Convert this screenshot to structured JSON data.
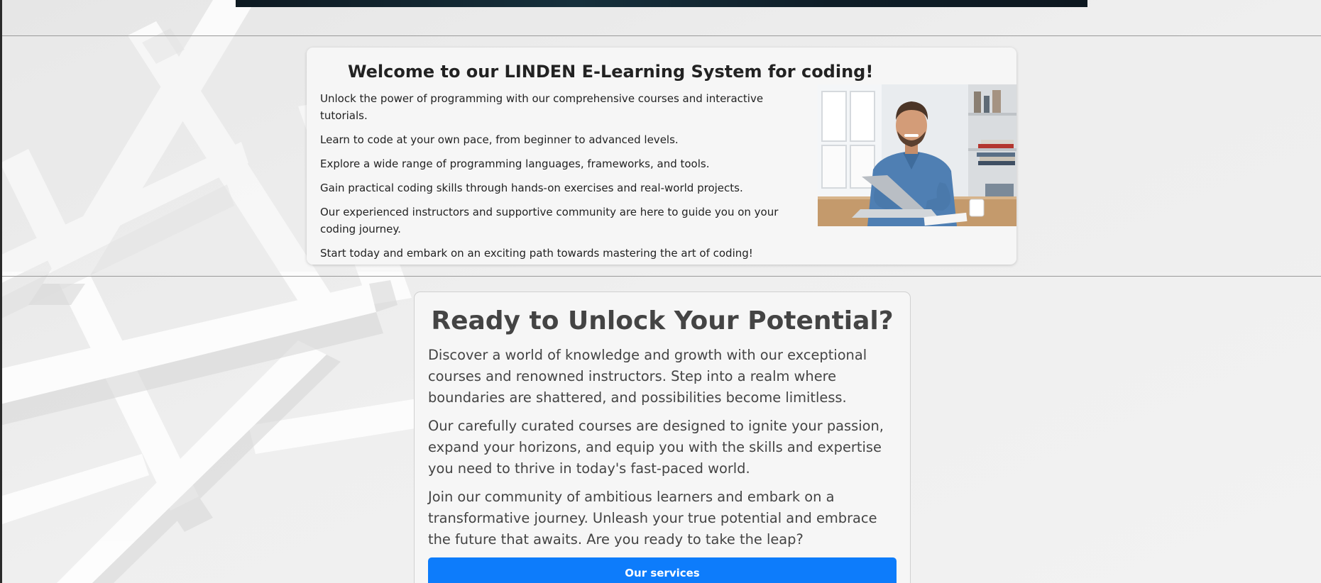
{
  "colors": {
    "page_bg": "#eeeeee",
    "card_bg": "#f6f6f6",
    "title_dark": "#222222",
    "body_text": "#444444",
    "primary_button": "#0d7cfb",
    "button_text": "#ffffff",
    "divider": "#9a9a9a"
  },
  "welcome": {
    "title": "Welcome to our LINDEN E-Learning System for coding!",
    "items": [
      "Unlock the power of programming with our comprehensive courses and interactive tutorials.",
      "Learn to code at your own pace, from beginner to advanced levels.",
      "Explore a wide range of programming languages, frameworks, and tools.",
      "Gain practical coding skills through hands-on exercises and real-world projects.",
      "Our experienced instructors and supportive community are here to guide you on your coding journey.",
      "Start today and embark on an exciting path towards mastering the art of coding!"
    ],
    "image_icon": "man-with-laptop-photo"
  },
  "potential": {
    "title": "Ready to Unlock Your Potential?",
    "paragraphs": [
      "Discover a world of knowledge and growth with our exceptional courses and renowned instructors. Step into a realm where boundaries are shattered, and possibilities become limitless.",
      "Our carefully curated courses are designed to ignite your passion, expand your horizons, and equip you with the skills and expertise you need to thrive in today's fast-paced world.",
      "Join our community of ambitious learners and embark on a transformative journey. Unleash your true potential and embrace the future that awaits. Are you ready to take the leap?"
    ],
    "button_label": "Our services"
  }
}
